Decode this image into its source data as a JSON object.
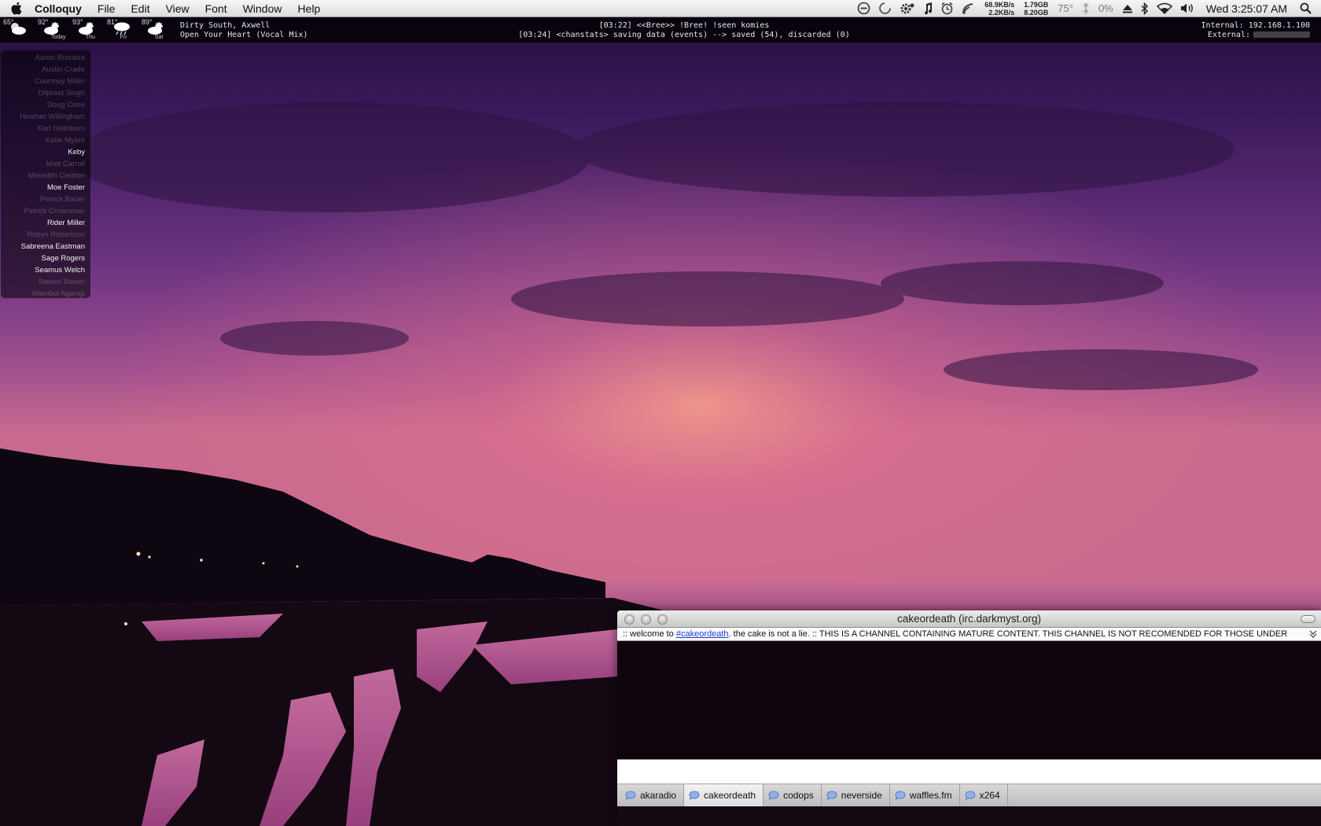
{
  "menubar": {
    "app_name": "Colloquy",
    "menus": [
      "File",
      "Edit",
      "View",
      "Font",
      "Window",
      "Help"
    ],
    "network": {
      "down": "68.9KB/s",
      "up": "2.2KB/s"
    },
    "memory": {
      "top": "1.79GB",
      "bottom": "8.20GB"
    },
    "cpu_temp": "75°",
    "battery": "0%",
    "clock": "Wed 3:25:07 AM",
    "status_icons": [
      "minus-circle-icon",
      "sync-circle-icon",
      "gear-icon",
      "music-note-icon",
      "alarm-clock-icon",
      "signal-bars-icon",
      "up-down-arrow-icon",
      "eject-icon",
      "bluetooth-icon",
      "wifi-icon",
      "volume-icon",
      "spotlight-icon"
    ]
  },
  "info_strip": {
    "weather": [
      {
        "temp": "65°",
        "label": "",
        "icon": "partly-cloudy-night-icon"
      },
      {
        "temp": "92°",
        "label": "Today",
        "icon": "partly-sunny-icon"
      },
      {
        "temp": "93°",
        "label": "Thu",
        "icon": "partly-sunny-icon"
      },
      {
        "temp": "81°",
        "label": "Fri",
        "icon": "rain-cloud-icon"
      },
      {
        "temp": "89°",
        "label": "Sat",
        "icon": "partly-sunny-icon"
      }
    ],
    "now_playing": {
      "artist": "Dirty South, Axwell",
      "track": "Open Your Heart (Vocal Mix)"
    },
    "irc_log": [
      "[03:22] <<Bree>> !Bree! !seen komies",
      "[03:24] <chanstats> saving data (events) --> saved (54), discarded (0)"
    ],
    "ip": {
      "internal": "Internal: 192.168.1.100",
      "external": "External:"
    }
  },
  "buddies": [
    {
      "name": "Aaron Breceda",
      "online": false
    },
    {
      "name": "Austin Crade",
      "online": false
    },
    {
      "name": "Courtney Miller",
      "online": false
    },
    {
      "name": "Dilpreet Singh",
      "online": false
    },
    {
      "name": "Doug Cone",
      "online": false
    },
    {
      "name": "Heather Willingham",
      "online": false
    },
    {
      "name": "Karl Steinborn",
      "online": false
    },
    {
      "name": "Katie Myers",
      "online": false
    },
    {
      "name": "Keby",
      "online": true
    },
    {
      "name": "Matt Carroll",
      "online": false
    },
    {
      "name": "Meredith Cleaton",
      "online": false
    },
    {
      "name": "Moe Foster",
      "online": true
    },
    {
      "name": "Patrick Bauer",
      "online": false
    },
    {
      "name": "Patrick Crownover",
      "online": false
    },
    {
      "name": "Rider Miller",
      "online": true
    },
    {
      "name": "Robyn Robertson",
      "online": false
    },
    {
      "name": "Sabreena Eastman",
      "online": true
    },
    {
      "name": "Sage Rogers",
      "online": true
    },
    {
      "name": "Seamus Welch",
      "online": true
    },
    {
      "name": "Steven Bower",
      "online": false
    },
    {
      "name": "Wambui Ngengi",
      "online": false
    }
  ],
  "irc_window": {
    "title": "cakeordeath (irc.darkmyst.org)",
    "topic": {
      "prefix": ":: welcome to ",
      "channel_link": "#cakeordeath",
      "suffix": ". the cake is not a lie. :: THIS IS A CHANNEL CONTAINING MATURE CONTENT. THIS CHANNEL IS NOT RECOMENDED FOR THOSE UNDER"
    },
    "input_value": "",
    "tabs": [
      {
        "label": "akaradio",
        "active": false
      },
      {
        "label": "cakeordeath",
        "active": true
      },
      {
        "label": "codops",
        "active": false
      },
      {
        "label": "neverside",
        "active": false
      },
      {
        "label": "waffles.fm",
        "active": false
      },
      {
        "label": "x264",
        "active": false
      }
    ]
  },
  "colors": {
    "sky_top": "#2a1045",
    "sky_mid": "#7a3d86",
    "sky_glow": "#e07a8c",
    "link": "#1a3fd0",
    "online_buddy": "#f2f2f2"
  }
}
